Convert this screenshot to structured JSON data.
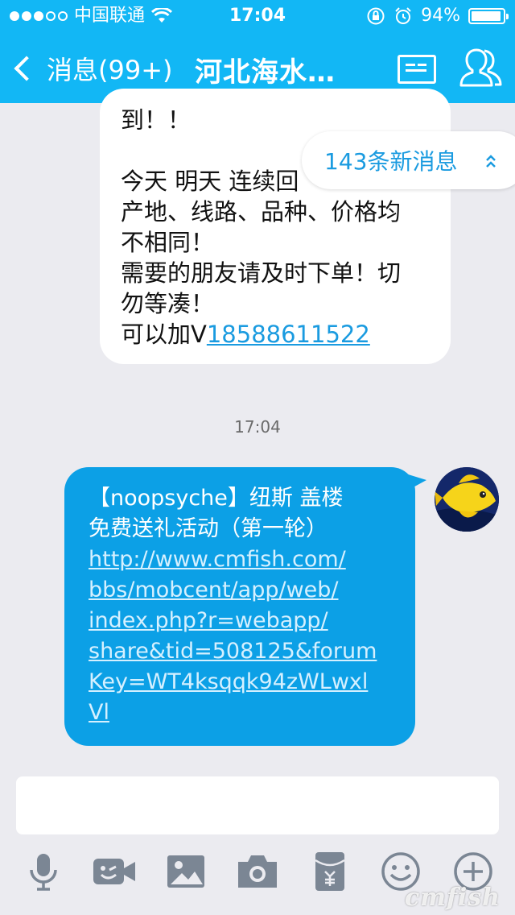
{
  "status_bar": {
    "carrier": "中国联通",
    "time": "17:04",
    "battery": "94%",
    "battery_level": 0.94
  },
  "nav": {
    "back_label": "消息(99+)",
    "title": "河北海水…"
  },
  "received_message": {
    "lines": [
      "到！！",
      "",
      "今天 明天 连续回",
      "产地、线路、品种、价格均",
      "不相同！",
      "需要的朋友请及时下单！切",
      "勿等凑！"
    ],
    "last_prefix": "可以加V",
    "phone": "18588611522"
  },
  "new_messages_pill": "143条新消息",
  "timestamp": "17:04",
  "sent_message": {
    "lines": [
      "【noopsyche】纽斯 盖楼",
      "免费送礼活动（第一轮）"
    ],
    "link_lines": [
      "http://www.cmfish.com/",
      "bbs/mobcent/app/web/",
      "index.php?r=webapp/",
      "share&tid=508125&forum",
      "Key=WT4ksqqk94zWLwxl",
      "Vl"
    ]
  },
  "watermark": "cmfish",
  "colors": {
    "header": "#12b7f5",
    "sent_bubble": "#0ca0e6",
    "link": "#1a9be0",
    "background": "#ebebf0",
    "toolbar_icon": "#7b8694"
  },
  "toolbar": [
    "microphone-icon",
    "video-icon",
    "image-icon",
    "camera-icon",
    "red-packet-icon",
    "emoji-icon",
    "plus-icon"
  ]
}
